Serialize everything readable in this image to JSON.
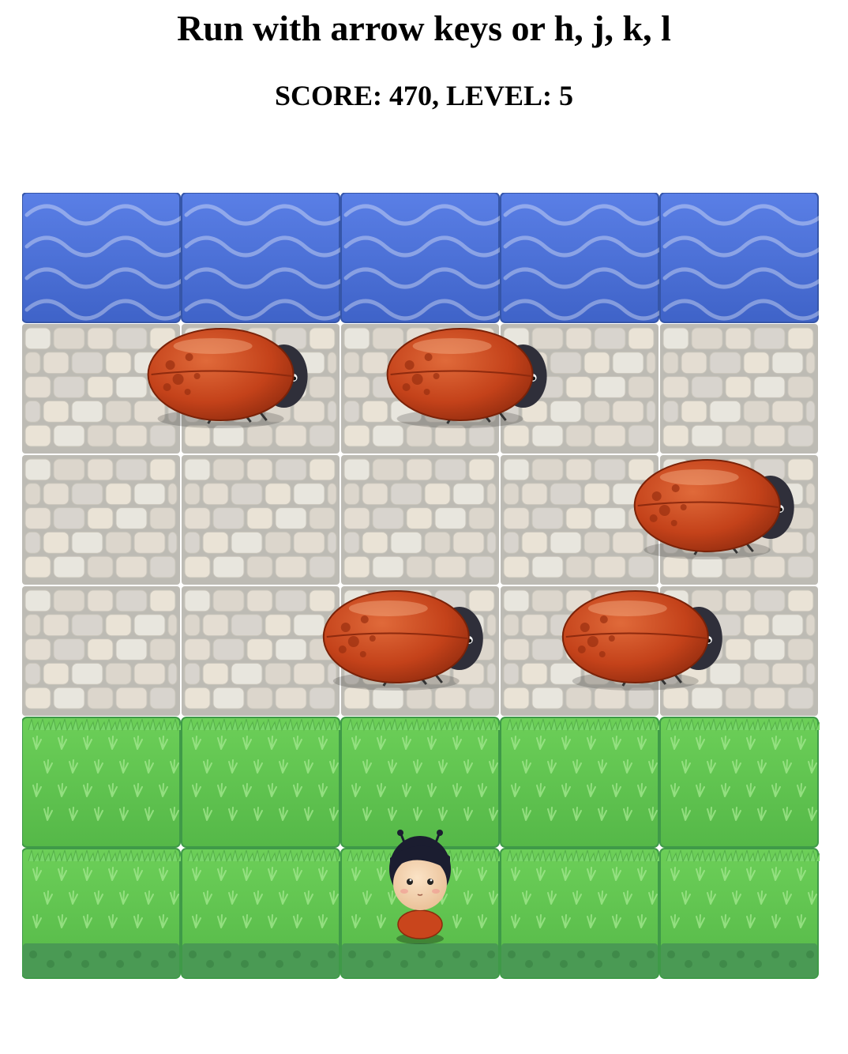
{
  "header": {
    "instructions": "Run with arrow keys or h, j, k, l"
  },
  "status": {
    "score_label": "SCORE:",
    "score": 470,
    "level_label": "LEVEL:",
    "level": 5,
    "text": "SCORE: 470, LEVEL: 5"
  },
  "board": {
    "columns": 5,
    "rows": [
      "water",
      "stone",
      "stone",
      "stone",
      "grass",
      "grass"
    ],
    "tile_icons": {
      "water": "water-tile",
      "stone": "stone-tile",
      "grass": "grass-tile"
    },
    "colors": {
      "water": "#4f73d9",
      "stone": "#d8d6cf",
      "grass": "#5cc24e",
      "grass_edge": "#3f9a48",
      "beetle_shell": "#c4421a",
      "beetle_head": "#2f2f3a"
    },
    "enemies": [
      {
        "name": "enemy-bug",
        "row": 1,
        "col": 0.8
      },
      {
        "name": "enemy-bug",
        "row": 1,
        "col": 2.3
      },
      {
        "name": "enemy-bug",
        "row": 2,
        "col": 3.85
      },
      {
        "name": "enemy-bug",
        "row": 3,
        "col": 1.9
      },
      {
        "name": "enemy-bug",
        "row": 3,
        "col": 3.4
      }
    ],
    "player": {
      "name": "player-character",
      "row": 5,
      "col": 2
    }
  }
}
